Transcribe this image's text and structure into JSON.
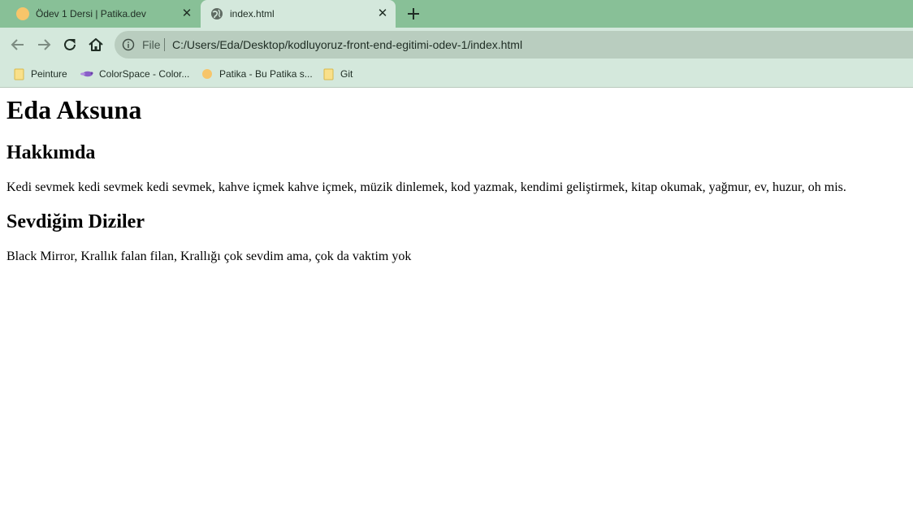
{
  "tabs": [
    {
      "title": "Ödev 1 Dersi | Patika.dev",
      "icon": "patika-favicon",
      "active": false
    },
    {
      "title": "index.html",
      "icon": "globe-icon",
      "active": true
    }
  ],
  "toolbar": {
    "back_icon": "back-arrow-icon",
    "forward_icon": "forward-arrow-icon",
    "reload_icon": "reload-icon",
    "home_icon": "home-icon",
    "omnibox": {
      "scheme_label": "File",
      "url": "C:/Users/Eda/Desktop/kodluyoruz-front-end-egitimi-odev-1/index.html"
    }
  },
  "bookmarks": [
    {
      "label": "Peinture",
      "icon": "folder-icon"
    },
    {
      "label": "ColorSpace - Color...",
      "icon": "colorspace-favicon"
    },
    {
      "label": "Patika - Bu Patika s...",
      "icon": "patika-favicon"
    },
    {
      "label": "Git",
      "icon": "folder-icon"
    }
  ],
  "page": {
    "title": "Eda Aksuna",
    "sections": [
      {
        "heading": "Hakkımda",
        "text": "Kedi sevmek kedi sevmek kedi sevmek, kahve içmek kahve içmek, müzik dinlemek, kod yazmak, kendimi geliştirmek, kitap okumak, yağmur, ev, huzur, oh mis."
      },
      {
        "heading": "Sevdiğim Diziler",
        "text": "Black Mirror, Krallık falan filan, Krallığı çok sevdim ama, çok da vaktim yok"
      }
    ]
  },
  "colors": {
    "tab_strip": "#88c097",
    "toolbar": "#d4e8dc",
    "omnibox": "#b9cdbf",
    "patika_orange": "#f7c56a",
    "folder_yellow": "#f9e08a",
    "colorspace_purple": "#8a5fc8"
  }
}
